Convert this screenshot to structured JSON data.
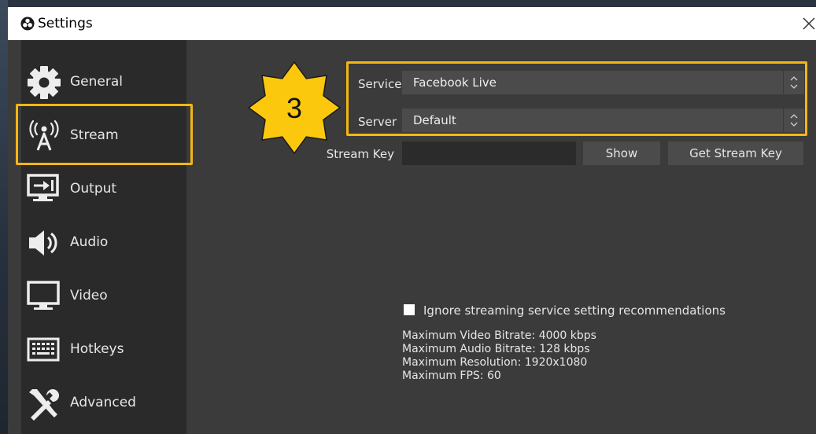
{
  "window": {
    "title": "Settings"
  },
  "sidebar": {
    "items": [
      {
        "label": "General"
      },
      {
        "label": "Stream"
      },
      {
        "label": "Output"
      },
      {
        "label": "Audio"
      },
      {
        "label": "Video"
      },
      {
        "label": "Hotkeys"
      },
      {
        "label": "Advanced"
      }
    ]
  },
  "stream": {
    "service_label": "Service",
    "service_value": "Facebook Live",
    "server_label": "Server",
    "server_value": "Default",
    "key_label": "Stream Key",
    "key_value": "",
    "show_button": "Show",
    "get_key_button": "Get Stream Key",
    "ignore_checkbox_label": "Ignore streaming service setting recommendations",
    "ignore_checked": false,
    "info": {
      "video_bitrate": "Maximum Video Bitrate: 4000 kbps",
      "audio_bitrate": "Maximum Audio Bitrate: 128 kbps",
      "resolution": "Maximum Resolution: 1920x1080",
      "fps": "Maximum FPS: 60"
    }
  },
  "callout": {
    "number": "3"
  },
  "colors": {
    "highlight": "#f3b614",
    "badge_fill": "#fcc80e",
    "window_bg": "#3b3b3b",
    "sidebar_bg": "#2a2a2a"
  }
}
